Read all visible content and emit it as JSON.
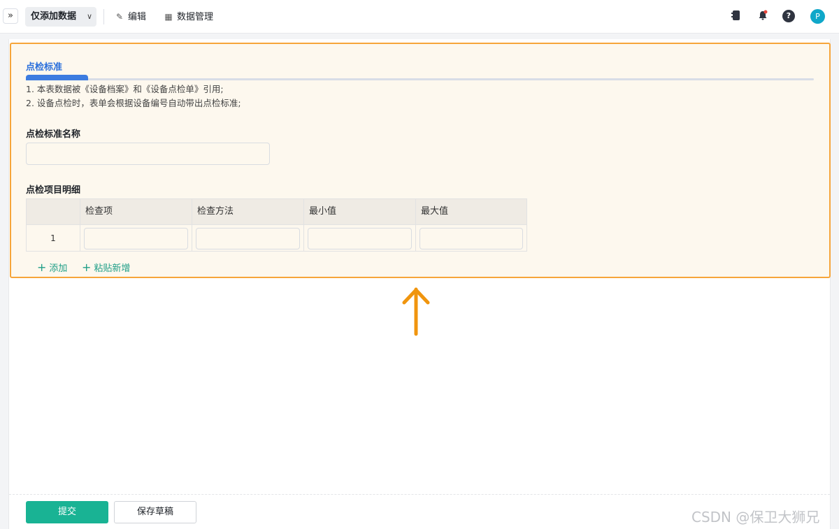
{
  "toolbar": {
    "expand_icon": "»",
    "mode_label": "仅添加数据",
    "edit_label": "编辑",
    "data_manage_label": "数据管理",
    "avatar_letter": "P",
    "help_glyph": "?"
  },
  "form": {
    "section_title": "点检标准",
    "description_lines": [
      "1. 本表数据被《设备档案》和《设备点检单》引用;",
      "2. 设备点检时，表单会根据设备编号自动带出点检标准;"
    ],
    "name_field_label": "点检标准名称",
    "name_field_value": "",
    "detail_label": "点检项目明细",
    "table": {
      "columns": [
        "检查项",
        "检查方法",
        "最小值",
        "最大值"
      ],
      "rows": [
        {
          "index": "1",
          "values": [
            "",
            "",
            "",
            ""
          ]
        }
      ]
    },
    "add_label": "添加",
    "paste_add_label": "粘贴新增"
  },
  "footer": {
    "submit_label": "提交",
    "draft_label": "保存草稿"
  },
  "watermark": "CSDN @保卫大狮兄",
  "colors": {
    "accent_green": "#19b394",
    "tab_blue": "#3c7ce0",
    "highlight_border": "#f6a53a",
    "arrow": "#f0950e"
  }
}
